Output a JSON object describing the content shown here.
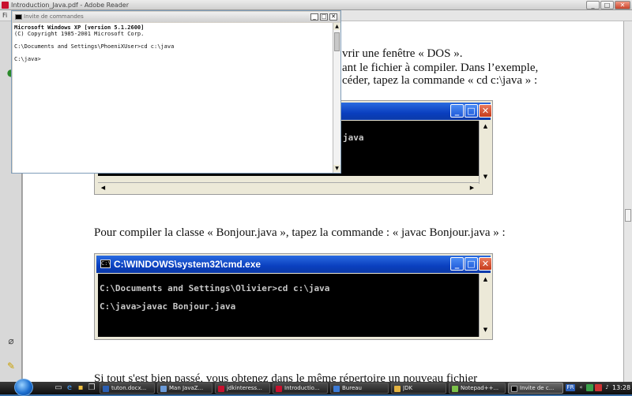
{
  "reader": {
    "title": "Introduction_Java.pdf - Adobe Reader",
    "menu_hint": "Fi"
  },
  "document": {
    "para1": {
      "line1": "vrir une fenêtre « DOS ».",
      "line2": "ant le fichier à compiler. Dans l’exemple,",
      "line3": "céder, tapez la commande « cd c:\\java » :"
    },
    "screenshot1": {
      "visible_text": "java"
    },
    "para2": "Pour compiler la classe « Bonjour.java », tapez la commande : « javac Bonjour.java » :",
    "screenshot2": {
      "title": "C:\\WINDOWS\\system32\\cmd.exe",
      "lines": [
        "C:\\Documents and Settings\\Olivier>cd c:\\java",
        "C:\\java>javac Bonjour.java"
      ]
    },
    "para3": "Si tout s'est bien passé, vous obtenez dans le même répertoire un nouveau fichier"
  },
  "cmd_window": {
    "title": "Invite de commandes",
    "lines": [
      "Microsoft Windows XP [version 5.1.2600]",
      "(C) Copyright 1985-2001 Microsoft Corp.",
      "",
      "C:\\Documents and Settings\\PhoeniXUser>cd c:\\java",
      "",
      "C:\\java>"
    ]
  },
  "taskbar": {
    "tasks": [
      {
        "label": "tuton.docx..."
      },
      {
        "label": "Man JavaZ..."
      },
      {
        "label": "jdkinteress..."
      },
      {
        "label": "Introductio..."
      },
      {
        "label": "Bureau"
      },
      {
        "label": "JDK"
      },
      {
        "label": "Notepad++..."
      },
      {
        "label": "Invite de c..."
      }
    ],
    "tray_lang": "FR",
    "clock": "13:28"
  },
  "colors": {
    "xp_title_blue": "#0a3fbf",
    "taskbar": "#1a1a1a",
    "acrobat_red": "#c8102e"
  }
}
